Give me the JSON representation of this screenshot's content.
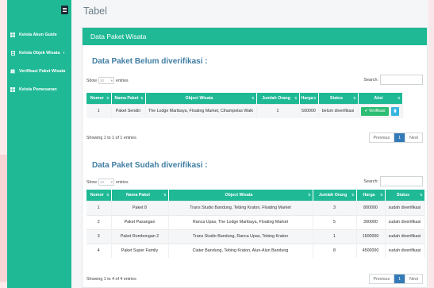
{
  "sidebar": {
    "menu_icon": "hamburger-menu-icon",
    "items": [
      {
        "label": "Kelola Akun Guide",
        "icon": "grid-icon"
      },
      {
        "label": "Kelola Objek Wisata",
        "icon": "document-icon",
        "chevron": "›"
      },
      {
        "label": "Verifikasi Paket Wisata",
        "icon": "book-icon"
      },
      {
        "label": "Kelola Pemesanan",
        "icon": "grid-icon"
      }
    ]
  },
  "page": {
    "title": "Tabel",
    "panel_title": "Data Paket Wisata"
  },
  "unverified": {
    "title": "Data Paket Belum diverifikasi :",
    "show_label": "Show",
    "show_value": "10",
    "entries_label": "entries",
    "search_label": "Search:",
    "columns": [
      "Nomor",
      "Nama Paket",
      "Object Wisata",
      "Jumlah Orang",
      "Harga",
      "Status",
      "Aksi"
    ],
    "rows": [
      {
        "no": "1",
        "name": "Paket Sendiri",
        "objects": "The Lodge Maribaya, Floating Market, Cihampelas Walk",
        "people": "1",
        "price": "500000",
        "status": "belum diverifikasi",
        "action": "Verifikasi"
      }
    ],
    "info": "Showing 1 to 1 of 1 entries",
    "pager": {
      "prev": "Previous",
      "page": "1",
      "next": "Next"
    }
  },
  "verified": {
    "title": "Data Paket Sudah diverifikasi :",
    "show_label": "Show",
    "show_value": "10",
    "entries_label": "entries",
    "search_label": "Search:",
    "columns": [
      "Nomor",
      "Nama Paket",
      "Object Wisata",
      "Jumlah Orang",
      "Harga",
      "Status"
    ],
    "rows": [
      {
        "no": "1",
        "name": "Paket 8",
        "objects": "Trans Studio Bandung, Tebing Kraton, Floating Market",
        "people": "3",
        "price": "800000",
        "status": "sudah diverifikasi"
      },
      {
        "no": "2",
        "name": "Paket Pasangan",
        "objects": "Ranca Upas, The Lodge Maribaya, Floating Market",
        "people": "5",
        "price": "300000",
        "status": "sudah diverifikasi"
      },
      {
        "no": "3",
        "name": "Paket Rombongan 2",
        "objects": "Trans Studio Bandung, Ranca Upas, Tebing Kraton",
        "people": "1",
        "price": "1500000",
        "status": "sudah diverifikasi"
      },
      {
        "no": "4",
        "name": "Paket Super Family",
        "objects": "Ciater Bandung, Tebing Kraton, Alun-Alun Bandung",
        "people": "8",
        "price": "4500000",
        "status": "sudah diverifikasi"
      }
    ],
    "info": "Showing 1 to 4 of 4 entries",
    "pager": {
      "prev": "Previous",
      "page": "1",
      "next": "Next"
    }
  }
}
